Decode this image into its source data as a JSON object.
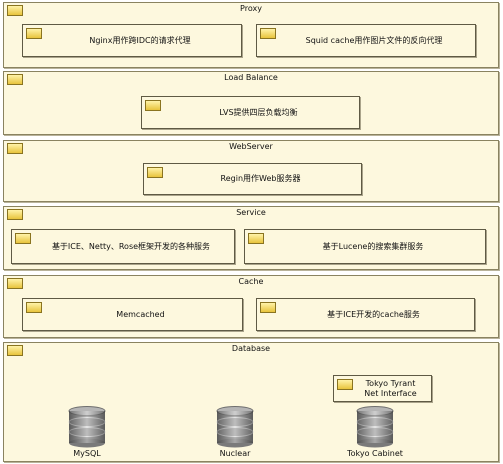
{
  "packages": [
    {
      "title": "Proxy",
      "components": [
        "Nginx用作跨IDC的请求代理",
        "Squid cache用作图片文件的反向代理"
      ]
    },
    {
      "title": "Load Balance",
      "components": [
        "LVS提供四层负载均衡"
      ]
    },
    {
      "title": "WebServer",
      "components": [
        "Regin用作Web服务器"
      ]
    },
    {
      "title": "Service",
      "components": [
        "基于ICE、Netty、Rose框架开发的各种服务",
        "基于Lucene的搜索集群服务"
      ]
    },
    {
      "title": "Cache",
      "components": [
        "Memcached",
        "基于ICE开发的cache服务"
      ]
    },
    {
      "title": "Database",
      "components": [
        "Tokyo Tyrant\nNet Interface"
      ],
      "databases": [
        "MySQL",
        "Nuclear",
        "Tokyo Cabinet"
      ]
    }
  ],
  "colors": {
    "package_fill": "#fdf8de",
    "folder_fill": "#f0d050",
    "db_fill": "#9a9a9a"
  }
}
